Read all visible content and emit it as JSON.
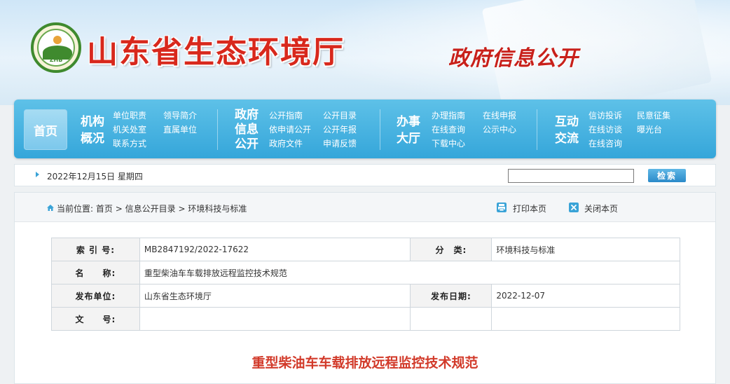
{
  "header": {
    "logo_text": "ZHB",
    "site_title": "山东省生态环境厅",
    "section_title": "政府信息公开"
  },
  "nav": {
    "home": "首页",
    "groups": [
      {
        "title": [
          "机构",
          "概况"
        ],
        "links": [
          [
            "单位职责",
            "领导简介"
          ],
          [
            "机关处室",
            "直属单位"
          ],
          [
            "联系方式"
          ]
        ]
      },
      {
        "title": [
          "政府",
          "信息",
          "公开"
        ],
        "links": [
          [
            "公开指南",
            "公开目录"
          ],
          [
            "依申请公开",
            "公开年报"
          ],
          [
            "政府文件",
            "申请反馈"
          ]
        ]
      },
      {
        "title": [
          "办事",
          "大厅"
        ],
        "links": [
          [
            "办理指南",
            "在线申报"
          ],
          [
            "在线查询",
            "公示中心"
          ],
          [
            "下载中心"
          ]
        ]
      },
      {
        "title": [
          "互动",
          "交流"
        ],
        "links": [
          [
            "信访投诉",
            "民意征集"
          ],
          [
            "在线访谈",
            "曝光台"
          ],
          [
            "在线咨询"
          ]
        ]
      }
    ]
  },
  "datebar": {
    "date": "2022年12月15日 星期四",
    "search_value": "",
    "search_button": "检索"
  },
  "breadcrumb": {
    "label": "当前位置:",
    "items": [
      "首页",
      "信息公开目录",
      "环境科技与标准"
    ],
    "separator": ">"
  },
  "tools": {
    "print": "打印本页",
    "close": "关闭本页"
  },
  "meta": {
    "index_label": "索 引 号:",
    "index_value": "MB2847192/2022-17622",
    "category_label": "分　类:",
    "category_value": "环境科技与标准",
    "name_label": "名　　称:",
    "name_value": "重型柴油车车载排放远程监控技术规范",
    "publisher_label": "发布单位:",
    "publisher_value": "山东省生态环境厅",
    "date_label": "发布日期:",
    "date_value": "2022-12-07",
    "docno_label": "文　　号:",
    "docno_value": ""
  },
  "document": {
    "title": "重型柴油车车载排放远程监控技术规范"
  },
  "colors": {
    "brand_red": "#d8281c",
    "nav_blue": "#35a6da",
    "title_red": "#d23a2a"
  }
}
